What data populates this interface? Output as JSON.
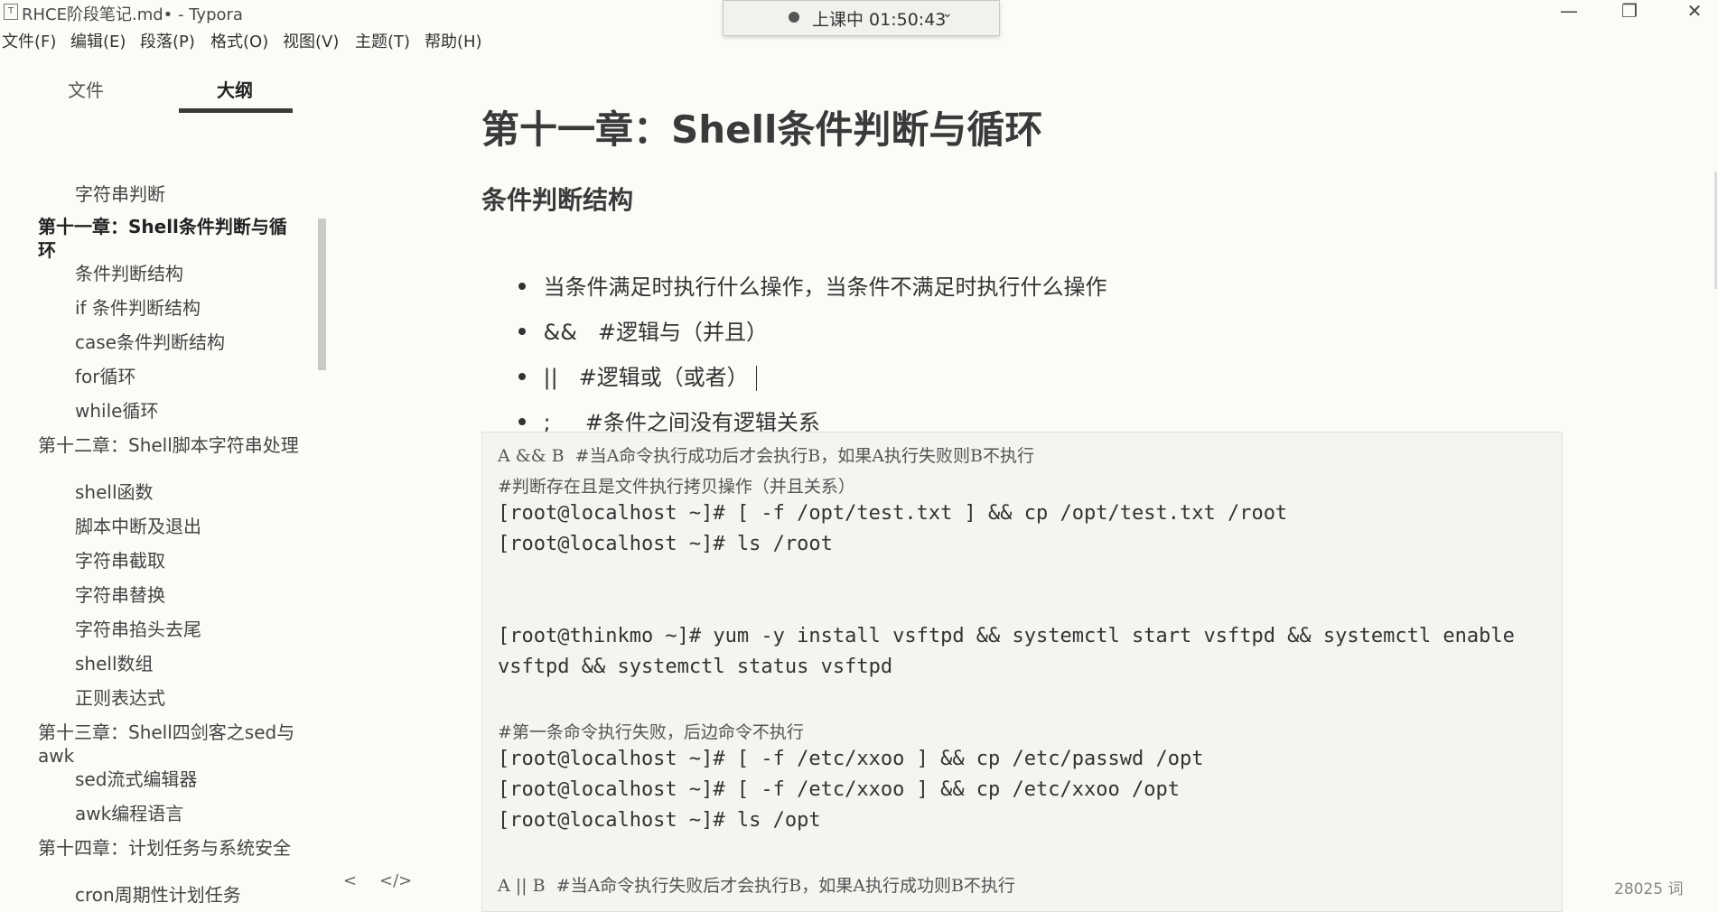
{
  "window": {
    "title": "RHCE阶段笔记.md• - Typora",
    "app_icon": "T",
    "recording": {
      "text": "上课中 01:50:43",
      "chevron": "⌄"
    },
    "controls": {
      "minimize": "—",
      "maximize": "❐",
      "close": "✕"
    }
  },
  "menu": [
    "文件(F)",
    "编辑(E)",
    "段落(P)",
    "格式(O)",
    "视图(V)",
    "主题(T)",
    "帮助(H)"
  ],
  "sidebar": {
    "tabs": [
      {
        "label": "文件"
      },
      {
        "label": "大纲",
        "active": true
      }
    ],
    "outline": [
      {
        "label": "字符串判断",
        "level": 2
      },
      {
        "label": "第十一章：Shell条件判断与循环",
        "level": 1,
        "active": true
      },
      {
        "label": "条件判断结构",
        "level": 2
      },
      {
        "label": "if 条件判断结构",
        "level": 2
      },
      {
        "label": "case条件判断结构",
        "level": 2
      },
      {
        "label": "for循环",
        "level": 2
      },
      {
        "label": "while循环",
        "level": 2
      },
      {
        "label": "第十二章：Shell脚本字符串处理",
        "level": 1
      },
      {
        "label": "shell函数",
        "level": 2
      },
      {
        "label": "脚本中断及退出",
        "level": 2
      },
      {
        "label": "字符串截取",
        "level": 2
      },
      {
        "label": "字符串替换",
        "level": 2
      },
      {
        "label": "字符串掐头去尾",
        "level": 2
      },
      {
        "label": "shell数组",
        "level": 2
      },
      {
        "label": "正则表达式",
        "level": 2
      },
      {
        "label": "第十三章：Shell四剑客之sed与awk",
        "level": 1
      },
      {
        "label": "sed流式编辑器",
        "level": 2
      },
      {
        "label": "awk编程语言",
        "level": 2
      },
      {
        "label": "第十四章：计划任务与系统安全",
        "level": 1
      },
      {
        "label": "cron周期性计划任务",
        "level": 2
      }
    ],
    "footer": {
      "back_icon": "<",
      "source_icon": "</>"
    }
  },
  "editor": {
    "h1": "第十一章：Shell条件判断与循环",
    "h2": "条件判断结构",
    "bullets": [
      "当条件满足时执行什么操作，当条件不满足时执行什么操作",
      "&&   #逻辑与（并且）",
      "||   #逻辑或（或者）",
      ";     #条件之间没有逻辑关系"
    ],
    "code_lines": [
      "A && B  #当A命令执行成功后才会执行B，如果A执行失败则B不执行",
      "#判断存在且是文件执行拷贝操作（并且关系）",
      "[root@localhost ~]# [ -f /opt/test.txt ] && cp /opt/test.txt /root",
      "[root@localhost ~]# ls /root",
      "",
      "",
      "[root@thinkmo ~]# yum -y install vsftpd && systemctl start vsftpd && systemctl enable",
      "vsftpd && systemctl status vsftpd",
      "",
      "#第一条命令执行失败，后边命令不执行",
      "[root@localhost ~]# [ -f /etc/xxoo ] && cp /etc/passwd /opt",
      "[root@localhost ~]# [ -f /etc/xxoo ] && cp /etc/xxoo /opt",
      "[root@localhost ~]# ls /opt",
      "",
      "A || B  #当A命令执行失败后才会执行B，如果A执行成功则B不执行"
    ],
    "word_count": "28025 词"
  }
}
